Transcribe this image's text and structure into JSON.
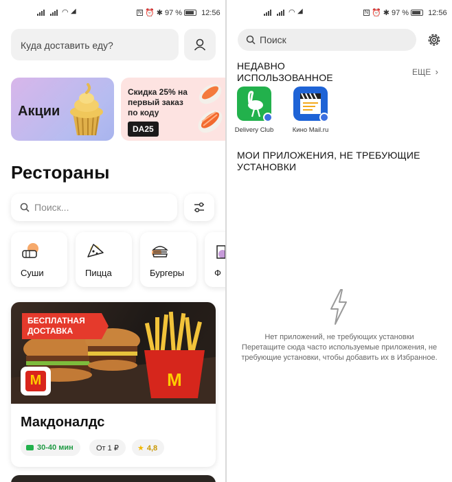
{
  "left": {
    "status": {
      "battery": "97 %",
      "time": "12:56"
    },
    "address_prompt": "Куда доставить еду?",
    "promo_stocks": "Акции",
    "promo_discount_text": "Скидка 25% на первый заказ по коду",
    "promo_code": "DA25",
    "restaurants_title": "Рестораны",
    "search_placeholder": "Поиск...",
    "categories": [
      {
        "label": "Суши"
      },
      {
        "label": "Пицца"
      },
      {
        "label": "Бургеры"
      },
      {
        "label": "Ф"
      }
    ],
    "restaurant": {
      "free_delivery_badge": "БЕСПЛАТНАЯ ДОСТАВКА",
      "name": "Макдоналдс",
      "delivery_time": "30-40 мин",
      "min_price": "От 1 ₽",
      "rating": "4,8"
    }
  },
  "right": {
    "status": {
      "battery": "97 %",
      "time": "12:56"
    },
    "search_placeholder": "Поиск",
    "recent_title": "НЕДАВНО ИСПОЛЬЗОВАННОЕ",
    "more_label": "ЕЩЕ",
    "recent_apps": [
      {
        "label": "Delivery Club",
        "icon": "delivery-club-ostrich-icon",
        "color": "#22b14c"
      },
      {
        "label": "Кино Mail.ru",
        "icon": "kino-mail-clapperboard-icon",
        "color": "#1e63d6"
      }
    ],
    "no_install_title": "МОИ ПРИЛОЖЕНИЯ, НЕ ТРЕБУЮЩИЕ УСТАНОВКИ",
    "empty_title": "Нет приложений, не требующих установки",
    "empty_hint": "Перетащите сюда часто используемые приложения, не требующие установки, чтобы добавить их в Избранное."
  },
  "colors": {
    "accent_red": "#e53a2c",
    "delivery_green": "#22b14c",
    "rating_yellow": "#f3b800"
  }
}
